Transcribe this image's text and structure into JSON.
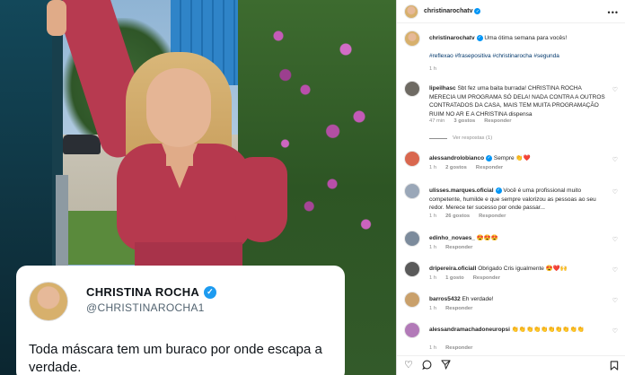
{
  "header": {
    "username": "christinarochatv",
    "more_icon": "more-horizontal-icon"
  },
  "caption": {
    "username": "christinarochatv",
    "text": "Uma ótima semana para vocês!",
    "hashtags": "#reflexao #frasepositiva #christinarocha #segunda",
    "time": "1 h"
  },
  "comments": [
    {
      "username": "lipeilhasc",
      "text": "Sbt fez uma baita burrada! CHRISTINA ROCHA MERECIA UM PROGRAMA SÓ DELA! NADA CONTRA A OUTROS CONTRATADOS DA CASA, MAIS TEM MUITA PROGRAMAÇÃO RUIM NO AR E A CHRISTINA dispensa",
      "time": "47 min",
      "likes": "3 gostos",
      "reply": "Responder",
      "view_replies": "Ver respostas (1)"
    },
    {
      "username": "alessandrolobianco",
      "text": "Sempre 👏❤️",
      "time": "1 h",
      "likes": "2 gostos",
      "reply": "Responder"
    },
    {
      "username": "ulisses.marques.oficial",
      "text": "Você é uma profissional muito competente, humilde e que sempre valorizou as pessoas ao seu redor. Merece ter sucesso por onde passar...",
      "time": "1 h",
      "likes": "26 gostos",
      "reply": "Responder"
    },
    {
      "username": "edinho_novaes_",
      "text": "😍😍😍",
      "time": "1 h",
      "likes": "",
      "reply": "Responder"
    },
    {
      "username": "dripereira.oficiall",
      "text": "Obrigado Cris igualmente 😍❤️🙌",
      "time": "1 h",
      "likes": "1 gosto",
      "reply": "Responder"
    },
    {
      "username": "barros5432",
      "text": "Eh verdade!",
      "time": "1 h",
      "likes": "",
      "reply": "Responder"
    },
    {
      "username": "alessandramachadoneuropsi",
      "text": "👏👏👏👏👏👏👏👏👏👏",
      "time": "1 h",
      "likes": "",
      "reply": "Responder"
    }
  ],
  "tweet": {
    "name": "CHRISTINA ROCHA",
    "handle": "@CHRISTINAROCHA1",
    "text": "Toda máscara tem um buraco por onde escapa a verdade."
  },
  "actions": {
    "like_icon": "heart-icon",
    "comment_icon": "comment-icon",
    "share_icon": "send-icon",
    "save_icon": "bookmark-icon"
  }
}
